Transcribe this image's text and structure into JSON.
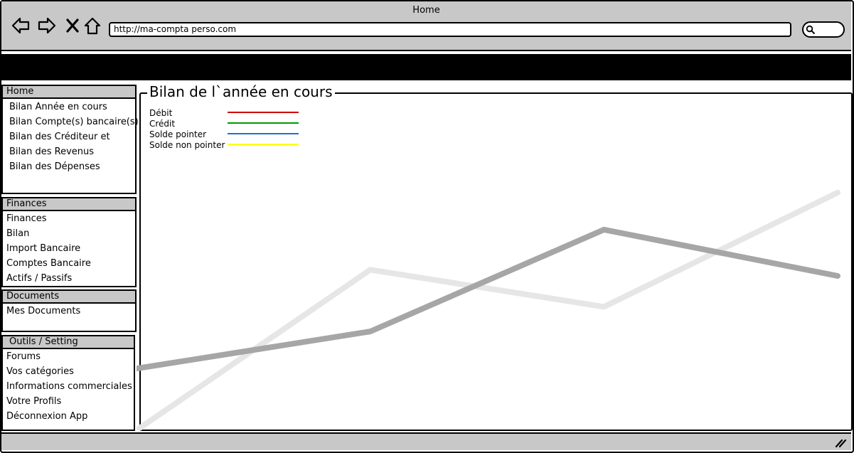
{
  "window": {
    "title": "Home"
  },
  "browser": {
    "url": "http://ma-compta perso.com",
    "nav_icons": [
      "back-arrow-icon",
      "forward-arrow-icon",
      "close-x-icon",
      "home-icon"
    ],
    "search_icon": "magnifier-icon"
  },
  "sidebar": {
    "home": {
      "title": "Home",
      "items": [
        "Bilan Année en cours",
        "Bilan Compte(s) bancaire(s)",
        "Bilan des Créditeur et",
        "Bilan des Revenus",
        "Bilan des Dépenses"
      ]
    },
    "finances": {
      "title": "Finances",
      "items": [
        "Finances",
        "Bilan",
        "Import Bancaire",
        "Comptes Bancaire",
        "Actifs / Passifs"
      ]
    },
    "documents": {
      "title": "Documents",
      "items": [
        "Mes Documents"
      ]
    },
    "outils": {
      "title": "Outils / Setting",
      "items": [
        "Forums",
        "Vos catégories",
        "Informations commerciales",
        "Votre Profils",
        "Déconnexion App"
      ]
    }
  },
  "main": {
    "title": "Bilan de l`année en cours"
  },
  "chart_data": {
    "type": "line",
    "legend": [
      {
        "name": "Débit",
        "color": "#cc0000"
      },
      {
        "name": "Crédit",
        "color": "#009900"
      },
      {
        "name": "Solde pointer",
        "color": "#1f6fd6"
      },
      {
        "name": "Solde non pointer",
        "color": "#ffff00"
      }
    ],
    "x": [
      0,
      1,
      2,
      3
    ],
    "series": [
      {
        "color": "#a6a6a6",
        "values": [
          0.2,
          0.32,
          0.65,
          0.5
        ]
      },
      {
        "color": "#e6e6e6",
        "values": [
          0.0,
          0.52,
          0.4,
          0.77
        ]
      }
    ],
    "ylim": [
      0,
      1
    ]
  }
}
